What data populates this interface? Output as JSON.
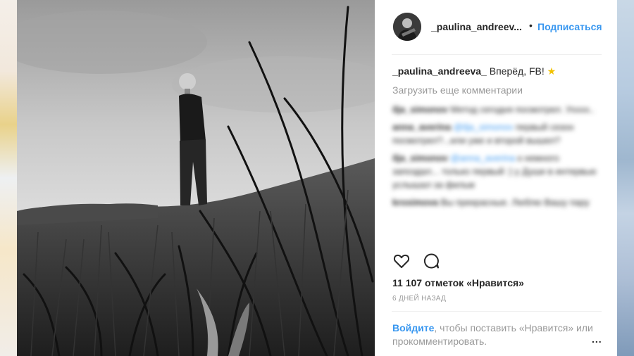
{
  "post": {
    "username": "_paulina_andreev...",
    "separator": "•",
    "follow_label": "Подписаться",
    "caption_user": "_paulina_andreeva_",
    "caption_text": " Вперёд, FB! ",
    "caption_emoji": "★",
    "load_more_label": "Загрузить еще комментарии",
    "comments": [
      {
        "user": "ilja_simonov",
        "segments": [
          " Метод сегодня посмотрел. Ухххх.."
        ]
      },
      {
        "user": "anna_averina",
        "mention": "@ilja_simonov",
        "text": " первый сезон посмотрел?...или уже и второй вышел?"
      },
      {
        "user": "ilja_simonov",
        "mention": "@anna_averina",
        "text": " к немного запоздал... только первый :) у Души в интервью услышал за фильм"
      },
      {
        "user": "krosimova",
        "text": " Вы прекрасные. Люблю Вашу пару"
      }
    ],
    "likes_text": "11 107 отметок «Нравится»",
    "time_text": "6 ДНЕЙ НАЗАД",
    "login_link": "Войдите",
    "login_text": ", чтобы поставить «Нравится» или прокомментировать.",
    "options_label": "..."
  },
  "icons": {
    "like": "heart-outline-icon",
    "comment": "speech-bubble-icon",
    "avatar": "profile-photo"
  }
}
